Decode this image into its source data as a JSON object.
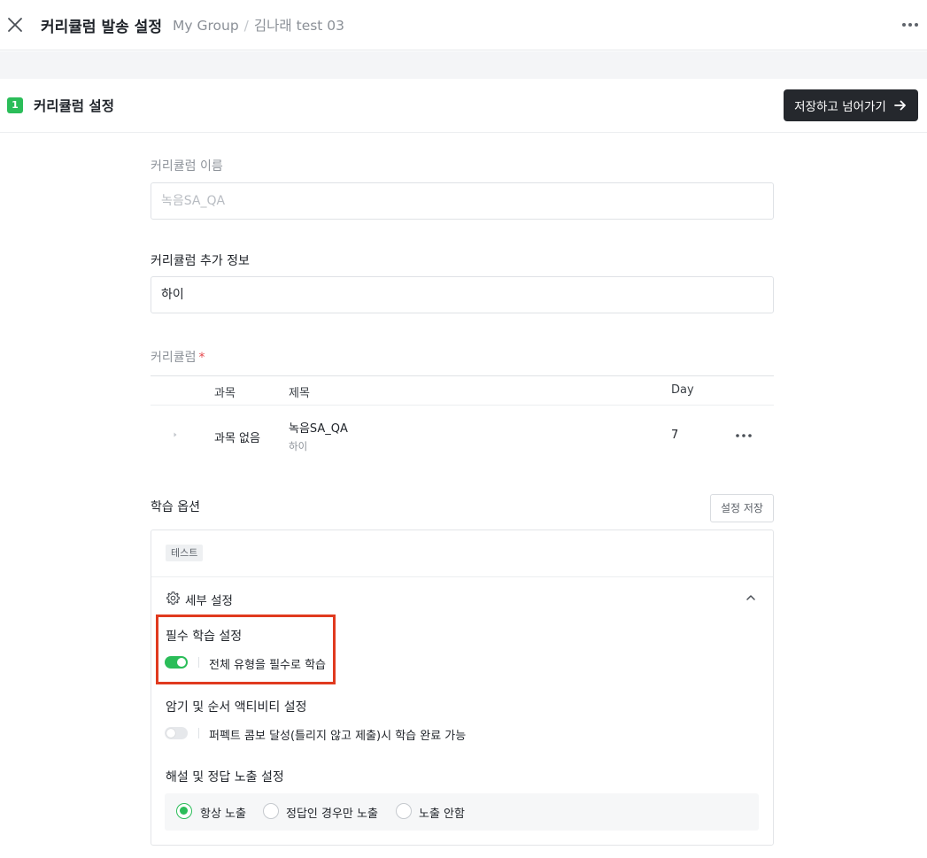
{
  "header": {
    "title": "커리큘럼 발송 설정",
    "breadcrumb": [
      "My Group",
      "김나래 test 03"
    ],
    "breadcrumb_separator": "/"
  },
  "section": {
    "step": "1",
    "title": "커리큘럼 설정",
    "save_next_label": "저장하고 넘어가기"
  },
  "form": {
    "name_label": "커리큘럼 이름",
    "name_value": "녹음SA_QA",
    "info_label": "커리큘럼 추가 정보",
    "info_value": "하이",
    "curriculum_label": "커리큘럼",
    "required_mark": "*"
  },
  "table": {
    "headers": [
      "과목",
      "제목",
      "Day"
    ],
    "rows": [
      {
        "subject": "과목 없음",
        "title": "녹음SA_QA",
        "subtitle": "하이",
        "day": "7"
      }
    ]
  },
  "options": {
    "title": "학습 옵션",
    "save_label": "설정 저장",
    "tag": "테스트",
    "detail_title": "세부 설정",
    "required_learning": {
      "title": "필수 학습 설정",
      "toggle_label": "전체 유형을 필수로 학습",
      "enabled": true
    },
    "memorize_order": {
      "title": "암기 및 순서 액티비티 설정",
      "toggle_label": "퍼펙트 콤보 달성(틀리지 않고 제출)시 학습 완료 가능",
      "enabled": false
    },
    "explanation": {
      "title": "해설 및 정답 노출 설정",
      "choices": [
        "항상 노출",
        "정답인 경우만 노출",
        "노출 안함"
      ],
      "selected": "항상 노출"
    }
  },
  "colors": {
    "accent_green": "#2bbd59",
    "primary_button": "#25282d",
    "highlight_border": "#e03a1f",
    "required_red": "#e5484d"
  },
  "icons": [
    "close-icon",
    "more-icon",
    "arrow-right-icon",
    "caret-right-icon",
    "gear-icon",
    "chevron-up-icon"
  ]
}
